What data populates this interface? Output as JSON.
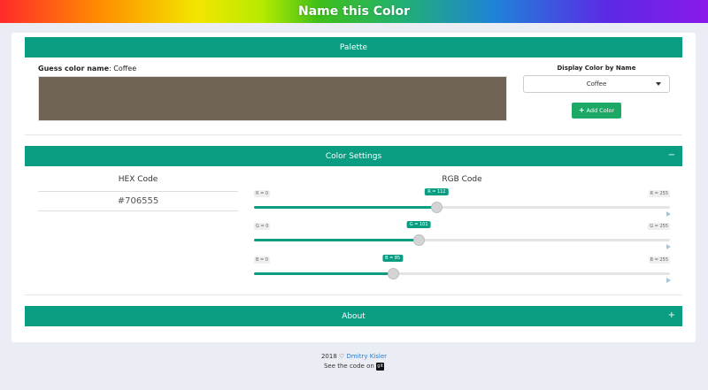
{
  "header": {
    "title": "Name this Color"
  },
  "palette": {
    "section_title": "Palette",
    "guess_label": "Guess color name",
    "guess_value": ": Coffee",
    "swatch_color": "#706555",
    "display_label": "Display Color by Name",
    "selected_option": "Coffee",
    "add_button_label": "Add Color",
    "add_icon": "plus-icon"
  },
  "settings": {
    "section_title": "Color Settings",
    "toggle": "−",
    "hex_title": "HEX Code",
    "hex_value": "#706555",
    "rgb_title": "RGB Code",
    "sliders": [
      {
        "min_label": "R = 0",
        "max_label": "R = 255",
        "current_label": "R = 112",
        "value": 112,
        "max": 255
      },
      {
        "min_label": "G = 0",
        "max_label": "G = 255",
        "current_label": "G = 101",
        "value": 101,
        "max": 255
      },
      {
        "min_label": "B = 0",
        "max_label": "B = 255",
        "current_label": "B = 85",
        "value": 85,
        "max": 255
      }
    ]
  },
  "about": {
    "section_title": "About",
    "toggle": "+"
  },
  "footer": {
    "year": "2018",
    "heart": "♡",
    "author": "Dmitry Kisler",
    "code_text": "See the code on",
    "git_icon": "git-icon",
    "git_glyph": "git"
  },
  "colors": {
    "accent": "#0b9d82",
    "button": "#1ca865",
    "page_bg": "#eaedf3"
  }
}
